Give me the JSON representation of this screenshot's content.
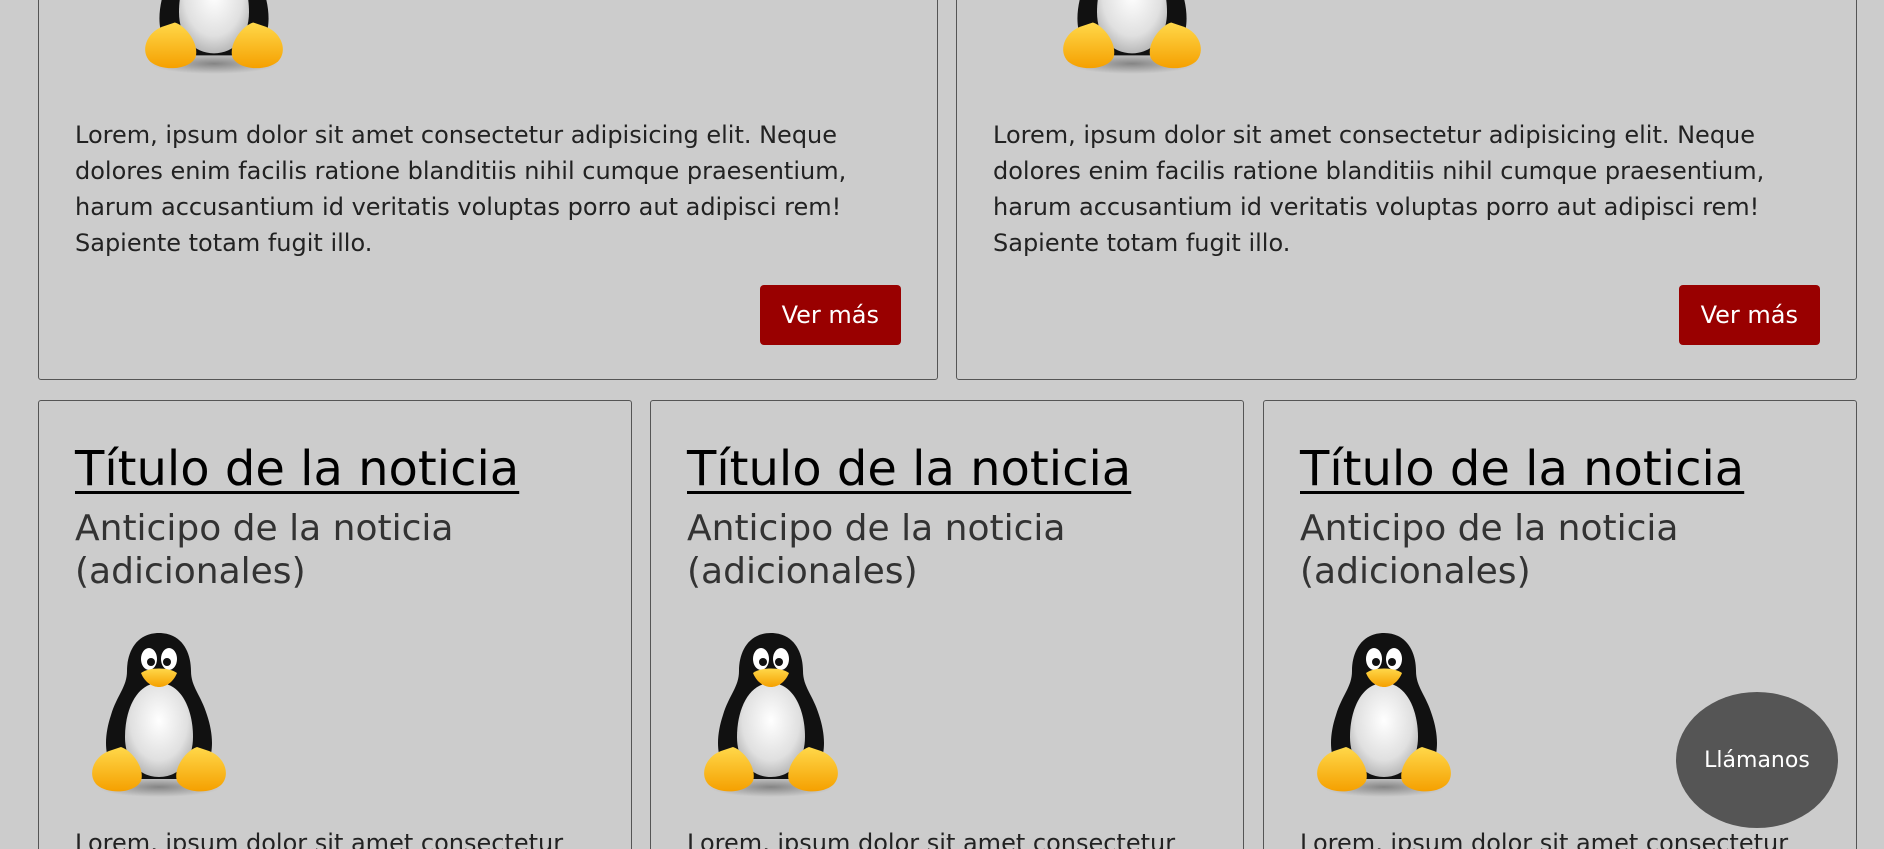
{
  "top_cards": [
    {
      "body": "Lorem, ipsum dolor sit amet consectetur adipisicing elit. Neque dolores enim facilis ratione blanditiis nihil cumque praesentium, harum accusantium id veritatis voluptas porro aut adipisci rem! Sapiente totam fugit illo.",
      "button_label": "Ver más"
    },
    {
      "body": "Lorem, ipsum dolor sit amet consectetur adipisicing elit. Neque dolores enim facilis ratione blanditiis nihil cumque praesentium, harum accusantium id veritatis voluptas porro aut adipisci rem! Sapiente totam fugit illo.",
      "button_label": "Ver más"
    }
  ],
  "news_cards": [
    {
      "title": "Título de la noticia",
      "subtitle": "Anticipo de la noticia (adicionales)",
      "body": "Lorem, ipsum dolor sit amet consectetur"
    },
    {
      "title": "Título de la noticia",
      "subtitle": "Anticipo de la noticia (adicionales)",
      "body": "Lorem, ipsum dolor sit amet consectetur"
    },
    {
      "title": "Título de la noticia",
      "subtitle": "Anticipo de la noticia (adicionales)",
      "body": "Lorem, ipsum dolor sit amet consectetur"
    }
  ],
  "call_button": {
    "label": "Llámanos"
  },
  "colors": {
    "background": "#cccccc",
    "button": "#990000",
    "call_button": "#555555"
  },
  "icons": {
    "news_image": "penguin-icon"
  }
}
